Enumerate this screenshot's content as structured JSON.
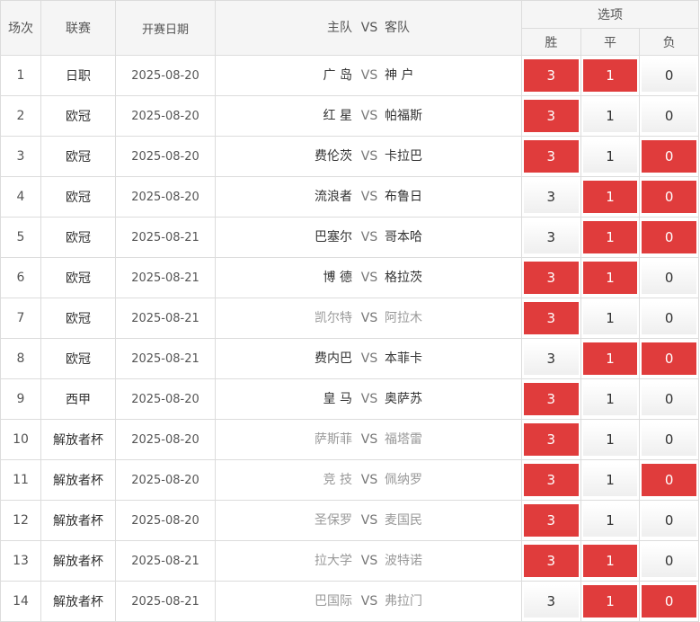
{
  "header": {
    "col_no": "场次",
    "col_league": "联赛",
    "col_date": "开赛日期",
    "col_home": "主队",
    "col_vs": "VS",
    "col_away": "客队",
    "col_options": "选项",
    "opt_win": "胜",
    "opt_draw": "平",
    "opt_lose": "负"
  },
  "option_values": {
    "win": "3",
    "draw": "1",
    "lose": "0"
  },
  "colors": {
    "selected": "#e03c3c",
    "border": "#dcdcdc",
    "muted_text": "#999999"
  },
  "rows": [
    {
      "no": "1",
      "league": "日职",
      "date": "2025-08-20",
      "home": "广 岛",
      "away": "神 户",
      "muted": false,
      "sel": [
        true,
        true,
        false
      ]
    },
    {
      "no": "2",
      "league": "欧冠",
      "date": "2025-08-20",
      "home": "红 星",
      "away": "帕福斯",
      "muted": false,
      "sel": [
        true,
        false,
        false
      ]
    },
    {
      "no": "3",
      "league": "欧冠",
      "date": "2025-08-20",
      "home": "费伦茨",
      "away": "卡拉巴",
      "muted": false,
      "sel": [
        true,
        false,
        true
      ]
    },
    {
      "no": "4",
      "league": "欧冠",
      "date": "2025-08-20",
      "home": "流浪者",
      "away": "布鲁日",
      "muted": false,
      "sel": [
        false,
        true,
        true
      ]
    },
    {
      "no": "5",
      "league": "欧冠",
      "date": "2025-08-21",
      "home": "巴塞尔",
      "away": "哥本哈",
      "muted": false,
      "sel": [
        false,
        true,
        true
      ]
    },
    {
      "no": "6",
      "league": "欧冠",
      "date": "2025-08-21",
      "home": "博 德",
      "away": "格拉茨",
      "muted": false,
      "sel": [
        true,
        true,
        false
      ]
    },
    {
      "no": "7",
      "league": "欧冠",
      "date": "2025-08-21",
      "home": "凯尔特",
      "away": "阿拉木",
      "muted": true,
      "sel": [
        true,
        false,
        false
      ]
    },
    {
      "no": "8",
      "league": "欧冠",
      "date": "2025-08-21",
      "home": "费内巴",
      "away": "本菲卡",
      "muted": false,
      "sel": [
        false,
        true,
        true
      ]
    },
    {
      "no": "9",
      "league": "西甲",
      "date": "2025-08-20",
      "home": "皇 马",
      "away": "奥萨苏",
      "muted": false,
      "sel": [
        true,
        false,
        false
      ]
    },
    {
      "no": "10",
      "league": "解放者杯",
      "date": "2025-08-20",
      "home": "萨斯菲",
      "away": "福塔雷",
      "muted": true,
      "sel": [
        true,
        false,
        false
      ]
    },
    {
      "no": "11",
      "league": "解放者杯",
      "date": "2025-08-20",
      "home": "竞 技",
      "away": "佩纳罗",
      "muted": true,
      "sel": [
        true,
        false,
        true
      ]
    },
    {
      "no": "12",
      "league": "解放者杯",
      "date": "2025-08-20",
      "home": "圣保罗",
      "away": "麦国民",
      "muted": true,
      "sel": [
        true,
        false,
        false
      ]
    },
    {
      "no": "13",
      "league": "解放者杯",
      "date": "2025-08-21",
      "home": "拉大学",
      "away": "波特诺",
      "muted": true,
      "sel": [
        true,
        true,
        false
      ]
    },
    {
      "no": "14",
      "league": "解放者杯",
      "date": "2025-08-21",
      "home": "巴国际",
      "away": "弗拉门",
      "muted": true,
      "sel": [
        false,
        true,
        true
      ]
    }
  ]
}
